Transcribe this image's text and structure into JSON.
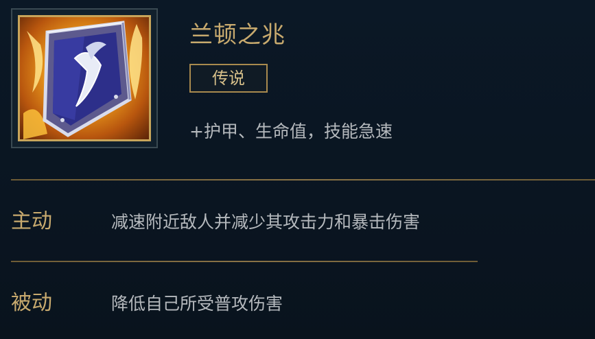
{
  "item": {
    "name": "兰顿之兆",
    "rarity": "传说",
    "stats": "+护甲、生命值，技能急速",
    "icon": "shield-icon"
  },
  "abilities": {
    "active": {
      "label": "主动",
      "description": "减速附近敌人并减少其攻击力和暴击伤害"
    },
    "passive": {
      "label": "被动",
      "description": "降低自己所受普攻伤害"
    }
  },
  "colors": {
    "background": "#0a1623",
    "gold": "#c8aa6e",
    "text": "#b5b9bd",
    "divider": "#8a7346"
  }
}
